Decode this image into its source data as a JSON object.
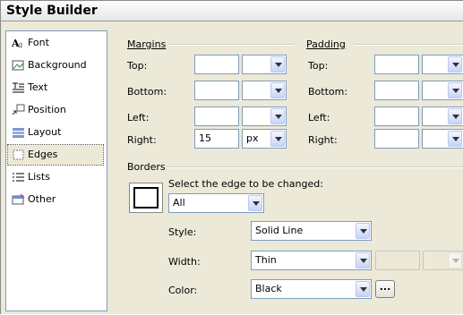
{
  "title": "Style Builder",
  "categories": [
    {
      "label": "Font",
      "icon": "font-icon"
    },
    {
      "label": "Background",
      "icon": "background-icon"
    },
    {
      "label": "Text",
      "icon": "text-icon"
    },
    {
      "label": "Position",
      "icon": "position-icon"
    },
    {
      "label": "Layout",
      "icon": "layout-icon"
    },
    {
      "label": "Edges",
      "icon": "edges-icon",
      "selected": true
    },
    {
      "label": "Lists",
      "icon": "lists-icon"
    },
    {
      "label": "Other",
      "icon": "other-icon"
    }
  ],
  "margins": {
    "heading": "Margins",
    "top": {
      "label": "Top:",
      "value": "",
      "unit": ""
    },
    "bottom": {
      "label": "Bottom:",
      "value": "",
      "unit": ""
    },
    "left": {
      "label": "Left:",
      "value": "",
      "unit": ""
    },
    "right": {
      "label": "Right:",
      "value": "15",
      "unit": "px"
    }
  },
  "padding": {
    "heading": "Padding",
    "top": {
      "label": "Top:",
      "value": "",
      "unit": ""
    },
    "bottom": {
      "label": "Bottom:",
      "value": "",
      "unit": ""
    },
    "left": {
      "label": "Left:",
      "value": "",
      "unit": ""
    },
    "right": {
      "label": "Right:",
      "value": "",
      "unit": ""
    }
  },
  "borders": {
    "heading": "Borders",
    "edge_prompt": "Select the edge to be changed:",
    "edge_value": "All",
    "style_label": "Style:",
    "style_value": "Solid Line",
    "width_label": "Width:",
    "width_value": "Thin",
    "width_extra_value": "",
    "width_extra_unit": "",
    "color_label": "Color:",
    "color_value": "Black",
    "color_button": "..."
  }
}
